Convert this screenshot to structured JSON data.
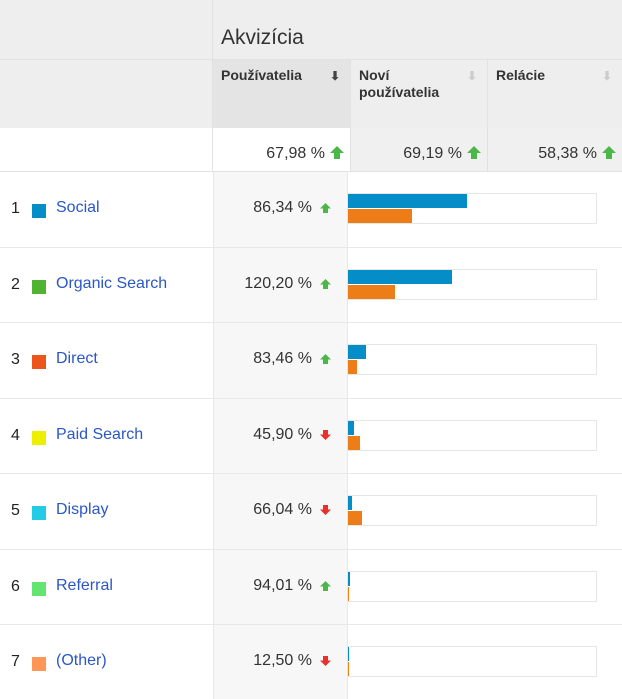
{
  "group_title": "Akvizícia",
  "columns": [
    {
      "label": "Používatelia",
      "sorted": true
    },
    {
      "label": "Noví používatelia",
      "sorted": false
    },
    {
      "label": "Relácie",
      "sorted": false
    }
  ],
  "totals": [
    {
      "value": "67,98 %",
      "trend": "up"
    },
    {
      "value": "69,19 %",
      "trend": "up"
    },
    {
      "value": "58,38 %",
      "trend": "up"
    }
  ],
  "colors": {
    "up": "#4cb749",
    "down": "#e8302c",
    "link": "#2a56c6",
    "bar_primary": "#058dc7",
    "bar_secondary": "#ed7e17"
  },
  "rows": [
    {
      "index": "1",
      "name": "Social",
      "swatch": "#058dc7",
      "value": "86,34 %",
      "trend": "up",
      "bar_blue": 0.48,
      "bar_orange": 0.26
    },
    {
      "index": "2",
      "name": "Organic Search",
      "swatch": "#50b432",
      "value": "120,20 %",
      "trend": "up",
      "bar_blue": 0.42,
      "bar_orange": 0.19
    },
    {
      "index": "3",
      "name": "Direct",
      "swatch": "#ed561b",
      "value": "83,46 %",
      "trend": "up",
      "bar_blue": 0.072,
      "bar_orange": 0.036
    },
    {
      "index": "4",
      "name": "Paid Search",
      "swatch": "#edef00",
      "value": "45,90 %",
      "trend": "down",
      "bar_blue": 0.024,
      "bar_orange": 0.048
    },
    {
      "index": "5",
      "name": "Display",
      "swatch": "#24cbe5",
      "value": "66,04 %",
      "trend": "down",
      "bar_blue": 0.016,
      "bar_orange": 0.056
    },
    {
      "index": "6",
      "name": "Referral",
      "swatch": "#64e572",
      "value": "94,01 %",
      "trend": "up",
      "bar_blue": 0.008,
      "bar_orange": 0.004
    },
    {
      "index": "7",
      "name": "(Other)",
      "swatch": "#ff9655",
      "value": "12,50 %",
      "trend": "down",
      "bar_blue": 0.004,
      "bar_orange": 0.004
    }
  ]
}
